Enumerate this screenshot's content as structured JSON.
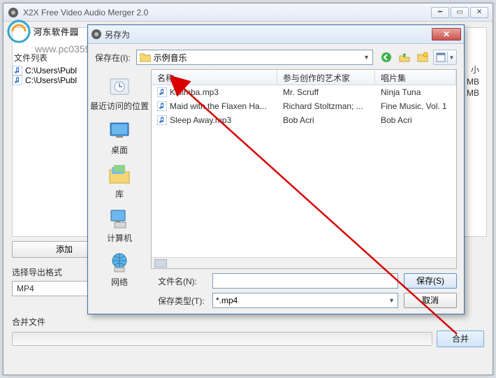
{
  "main_window": {
    "title": "X2X Free Video Audio Merger 2.0",
    "file_list_label": "文件列表",
    "files": [
      {
        "path": "C:\\Users\\Publ",
        "size": "MB"
      },
      {
        "path": "C:\\Users\\Publ",
        "size": "MB"
      }
    ],
    "size_header": "小",
    "add_button": "添加",
    "format_label": "选择导出格式",
    "format_value": "MP4",
    "merge_label": "合并文件",
    "merge_button": "合并"
  },
  "watermark": {
    "brand": "河东软件园",
    "url": "www.pc0359.cn"
  },
  "save_dialog": {
    "title": "另存为",
    "save_in_label": "保存在(I):",
    "current_folder": "示例音乐",
    "places": {
      "recent": "最近访问的位置",
      "desktop": "桌面",
      "library": "库",
      "computer": "计算机",
      "network": "网络"
    },
    "columns": {
      "name": "名称",
      "artist": "参与创作的艺术家",
      "album": "唱片集"
    },
    "rows": [
      {
        "name": "Kalimba.mp3",
        "artist": "Mr. Scruff",
        "album": "Ninja Tuna"
      },
      {
        "name": "Maid with the Flaxen Ha...",
        "artist": "Richard Stoltzman; ...",
        "album": "Fine Music, Vol. 1"
      },
      {
        "name": "Sleep Away.mp3",
        "artist": "Bob Acri",
        "album": "Bob Acri"
      }
    ],
    "filename_label": "文件名(N):",
    "filename_value": "",
    "filetype_label": "保存类型(T):",
    "filetype_value": "*.mp4",
    "save_button": "保存(S)",
    "cancel_button": "取消"
  }
}
